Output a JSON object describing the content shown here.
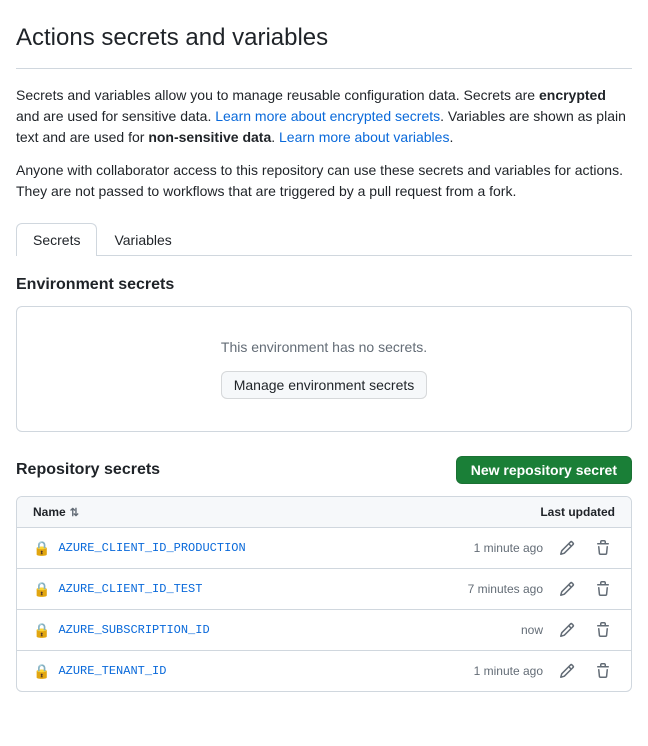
{
  "page": {
    "title": "Actions secrets and variables",
    "description1": "Secrets and variables allow you to manage reusable configuration data. Secrets are ",
    "description1_bold": "encrypted",
    "description1_cont": " and are used for sensitive data. ",
    "link1_text": "Learn more about encrypted secrets",
    "link1_href": "#",
    "description1_end": ". Variables are shown as plain text and are used for ",
    "description2_bold": "non-sensitive data",
    "description2_end": ". ",
    "link2_text": "Learn more about variables",
    "link2_href": "#",
    "notice": "Anyone with collaborator access to this repository can use these secrets and variables for actions. They are not passed to workflows that are triggered by a pull request from a fork."
  },
  "tabs": [
    {
      "id": "secrets",
      "label": "Secrets",
      "active": true
    },
    {
      "id": "variables",
      "label": "Variables",
      "active": false
    }
  ],
  "environment_secrets": {
    "title": "Environment secrets",
    "empty_message": "This environment has no secrets.",
    "manage_button_label": "Manage environment secrets"
  },
  "repository_secrets": {
    "title": "Repository secrets",
    "new_button_label": "New repository secret",
    "table": {
      "col_name": "Name",
      "col_updated": "Last updated",
      "rows": [
        {
          "name": "AZURE_CLIENT_ID_PRODUCTION",
          "updated": "1 minute ago"
        },
        {
          "name": "AZURE_CLIENT_ID_TEST",
          "updated": "7 minutes ago"
        },
        {
          "name": "AZURE_SUBSCRIPTION_ID",
          "updated": "now"
        },
        {
          "name": "AZURE_TENANT_ID",
          "updated": "1 minute ago"
        }
      ]
    }
  },
  "icons": {
    "lock": "🔒",
    "sort": "⇅"
  }
}
